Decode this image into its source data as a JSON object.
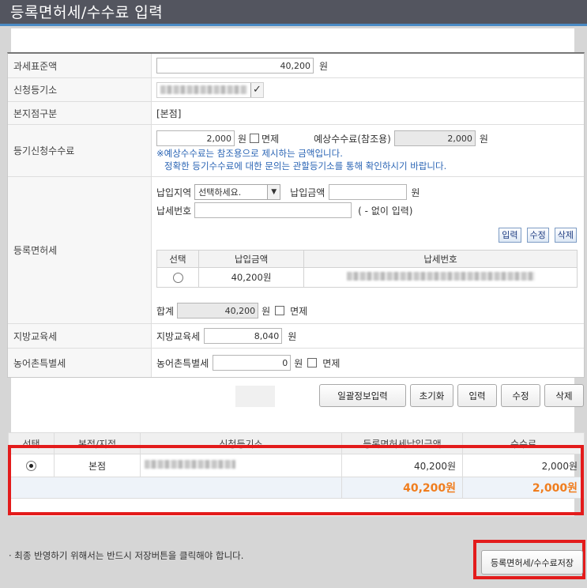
{
  "title": "등록면허세/수수료 입력",
  "form": {
    "tax_base": {
      "label": "과세표준액",
      "value": "40,200",
      "unit": "원"
    },
    "registry_office": {
      "label": "신청등기소"
    },
    "branch_type": {
      "label": "본지점구분",
      "value": "[본점]"
    },
    "fee": {
      "label": "등기신청수수료",
      "value": "2,000",
      "unit": "원",
      "exempt_label": "면제",
      "expected_label": "예상수수료(참조용)",
      "expected_value": "2,000",
      "expected_unit": "원",
      "note1": "※예상수수료는 참조용으로 제시하는 금액입니다.",
      "note2": "정확한 등기수수료에 대한 문의는 관할등기소를 통해 확인하시기 바랍니다."
    },
    "license_tax": {
      "label": "등록면허세",
      "region_label": "납입지역",
      "region_selected": "선택하세요.",
      "amount_label": "납입금액",
      "amount_value": "",
      "amount_unit": "원",
      "taxno_label": "납세번호",
      "taxno_value": "",
      "taxno_hint": "( - 없이 입력)",
      "btn_input": "입력",
      "btn_edit": "수정",
      "btn_delete": "삭제",
      "table": {
        "headers": [
          "선택",
          "납입금액",
          "납세번호"
        ],
        "rows": [
          {
            "amount": "40,200원"
          }
        ]
      },
      "total_label": "합계",
      "total_value": "40,200",
      "total_unit": "원",
      "total_exempt_label": "면제"
    },
    "edu_tax": {
      "label": "지방교육세",
      "inner_label": "지방교육세",
      "value": "8,040",
      "unit": "원"
    },
    "rural_tax": {
      "label": "농어촌특별세",
      "inner_label": "농어촌특별세",
      "value": "0",
      "unit": "원",
      "exempt_label": "면제"
    }
  },
  "actions": {
    "bulk_input": "일괄정보입력",
    "reset": "초기화",
    "input": "입력",
    "edit": "수정",
    "delete": "삭제"
  },
  "list": {
    "headers": [
      "선택",
      "본점/지점",
      "신청등기소",
      "등록면허세납입금액",
      "수수료"
    ],
    "rows": [
      {
        "branch": "본점",
        "amount": "40,200원",
        "fee": "2,000원"
      }
    ],
    "total_amount": "40,200원",
    "total_fee": "2,000원"
  },
  "footer": {
    "notice": "· 최종 반영하기 위해서는 반드시 저장버튼을 클릭해야 합니다.",
    "save_button": "등록면허세/수수료저장"
  },
  "colors": {
    "title_bar": "#53555f",
    "accent": "#4a8ac4",
    "highlight": "#e31b1b",
    "total": "#f07d1e"
  }
}
